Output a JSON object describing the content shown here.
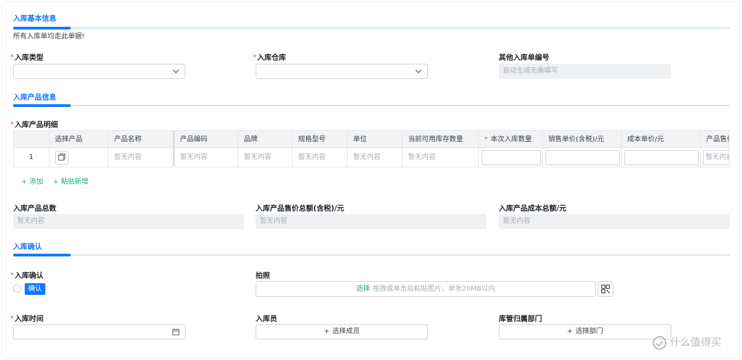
{
  "sections": {
    "basic": "入库基本信息",
    "products": "入库产品信息",
    "confirm": "入库确认"
  },
  "basic": {
    "hint": "所有入库单均走此单据!",
    "type_label": "入库类型",
    "warehouse_label": "入库仓库",
    "other_no_label": "其他入库单编号",
    "other_no_placeholder": "自动生成无需填写"
  },
  "products": {
    "detail_label": "入库产品明细",
    "columns": [
      "选择产品",
      "产品名称",
      "产品编码",
      "品牌",
      "规格型号",
      "单位",
      "当前可用库存数量",
      "本次入库数量",
      "销售单价(含税)/元",
      "成本单价/元",
      "产品售价"
    ],
    "row": {
      "index": "1",
      "empty": "暂无内容"
    },
    "add_label": "添加",
    "paste_label": "粘贴新增"
  },
  "totals": {
    "count_label": "入库产品总数",
    "sale_total_label": "入库产品售价总额(含税)/元",
    "cost_total_label": "入库产品成本总额/元",
    "empty": "暂无内容"
  },
  "confirm": {
    "confirm_label": "入库确认",
    "confirm_tag": "确认",
    "photo_label": "拍照",
    "upload_select": "选择",
    "upload_desc": "拖拽或单击后粘贴图片，单张20MB以内",
    "time_label": "入库时间",
    "staff_label": "入库员",
    "staff_button": "选择成员",
    "dept_label": "库管归属部门",
    "dept_button": "选择部门"
  },
  "watermark": "什么值得买",
  "required_mark": "*",
  "colors": {
    "accent": "#1677ff",
    "link": "#22a77c",
    "required": "#f54a45"
  }
}
